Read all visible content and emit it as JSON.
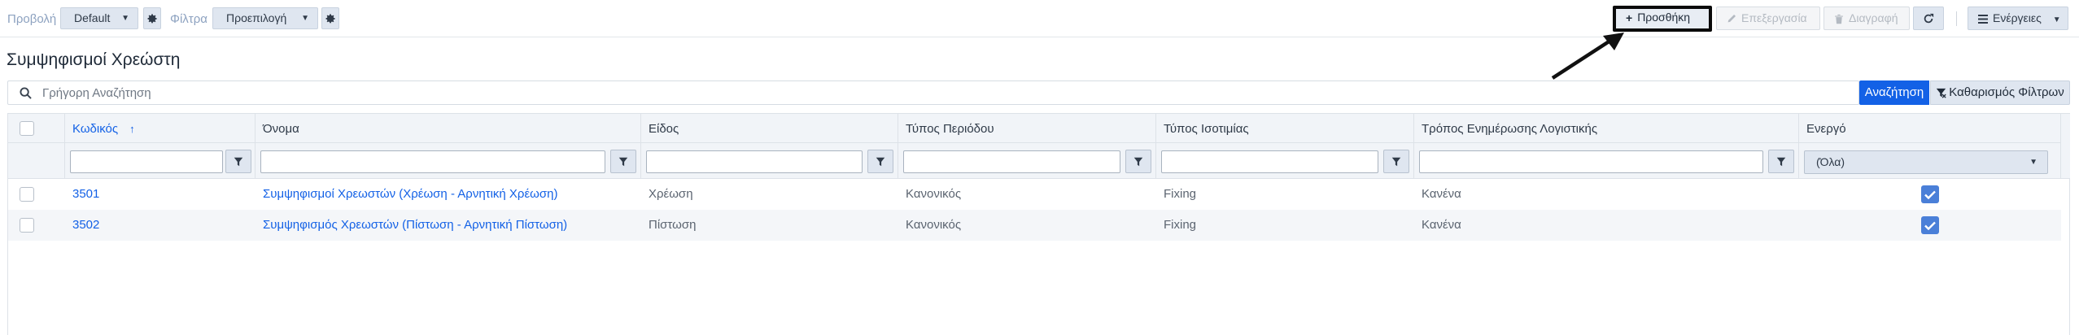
{
  "toolbar": {
    "view_label": "Προβολή",
    "view_value": "Default",
    "filter_label": "Φίλτρα",
    "filter_value": "Προεπιλογή",
    "add_label": "Προσθήκη",
    "edit_label": "Επεξεργασία",
    "delete_label": "Διαγραφή",
    "actions_label": "Ενέργειες"
  },
  "page": {
    "title": "Συμψηφισμοί Χρεώστη"
  },
  "search": {
    "placeholder": "Γρήγορη Αναζήτηση",
    "search_button": "Αναζήτηση",
    "clear_button": "Καθαρισμός Φίλτρων"
  },
  "grid": {
    "columns": [
      "Κωδικός",
      "Όνομα",
      "Είδος",
      "Τύπος Περιόδου",
      "Τύπος Ισοτιμίας",
      "Τρόπος Ενημέρωσης Λογιστικής",
      "Ενεργό"
    ],
    "sorted_column": "Κωδικός",
    "active_filter_value": "(Όλα)",
    "rows": [
      {
        "code": "3501",
        "name": "Συμψηφισμοί Χρεωστών (Χρέωση - Αρνητική Χρέωση)",
        "kind": "Χρέωση",
        "period_type": "Κανονικός",
        "rate_type": "Fixing",
        "accounting": "Κανένα",
        "active": true
      },
      {
        "code": "3502",
        "name": "Συμψηφισμός Χρεωστών (Πίστωση - Αρνητική Πίστωση)",
        "kind": "Πίστωση",
        "period_type": "Κανονικός",
        "rate_type": "Fixing",
        "accounting": "Κανένα",
        "active": true
      }
    ]
  },
  "icons": {
    "gear": "gear-icon",
    "plus": "plus-icon",
    "pencil": "pencil-icon",
    "trash": "trash-icon",
    "refresh": "refresh-icon",
    "menu": "hamburger-icon",
    "search": "search-icon",
    "filter": "funnel-icon",
    "clear_filter": "filter-clear-icon",
    "check": "check-icon",
    "sort_up": "arrow-up-icon"
  },
  "colors": {
    "accent": "#1361e6",
    "checkbox_on": "#4a7fd8",
    "button_bg": "#dfe6f0",
    "header_bg": "#f1f4f8"
  }
}
